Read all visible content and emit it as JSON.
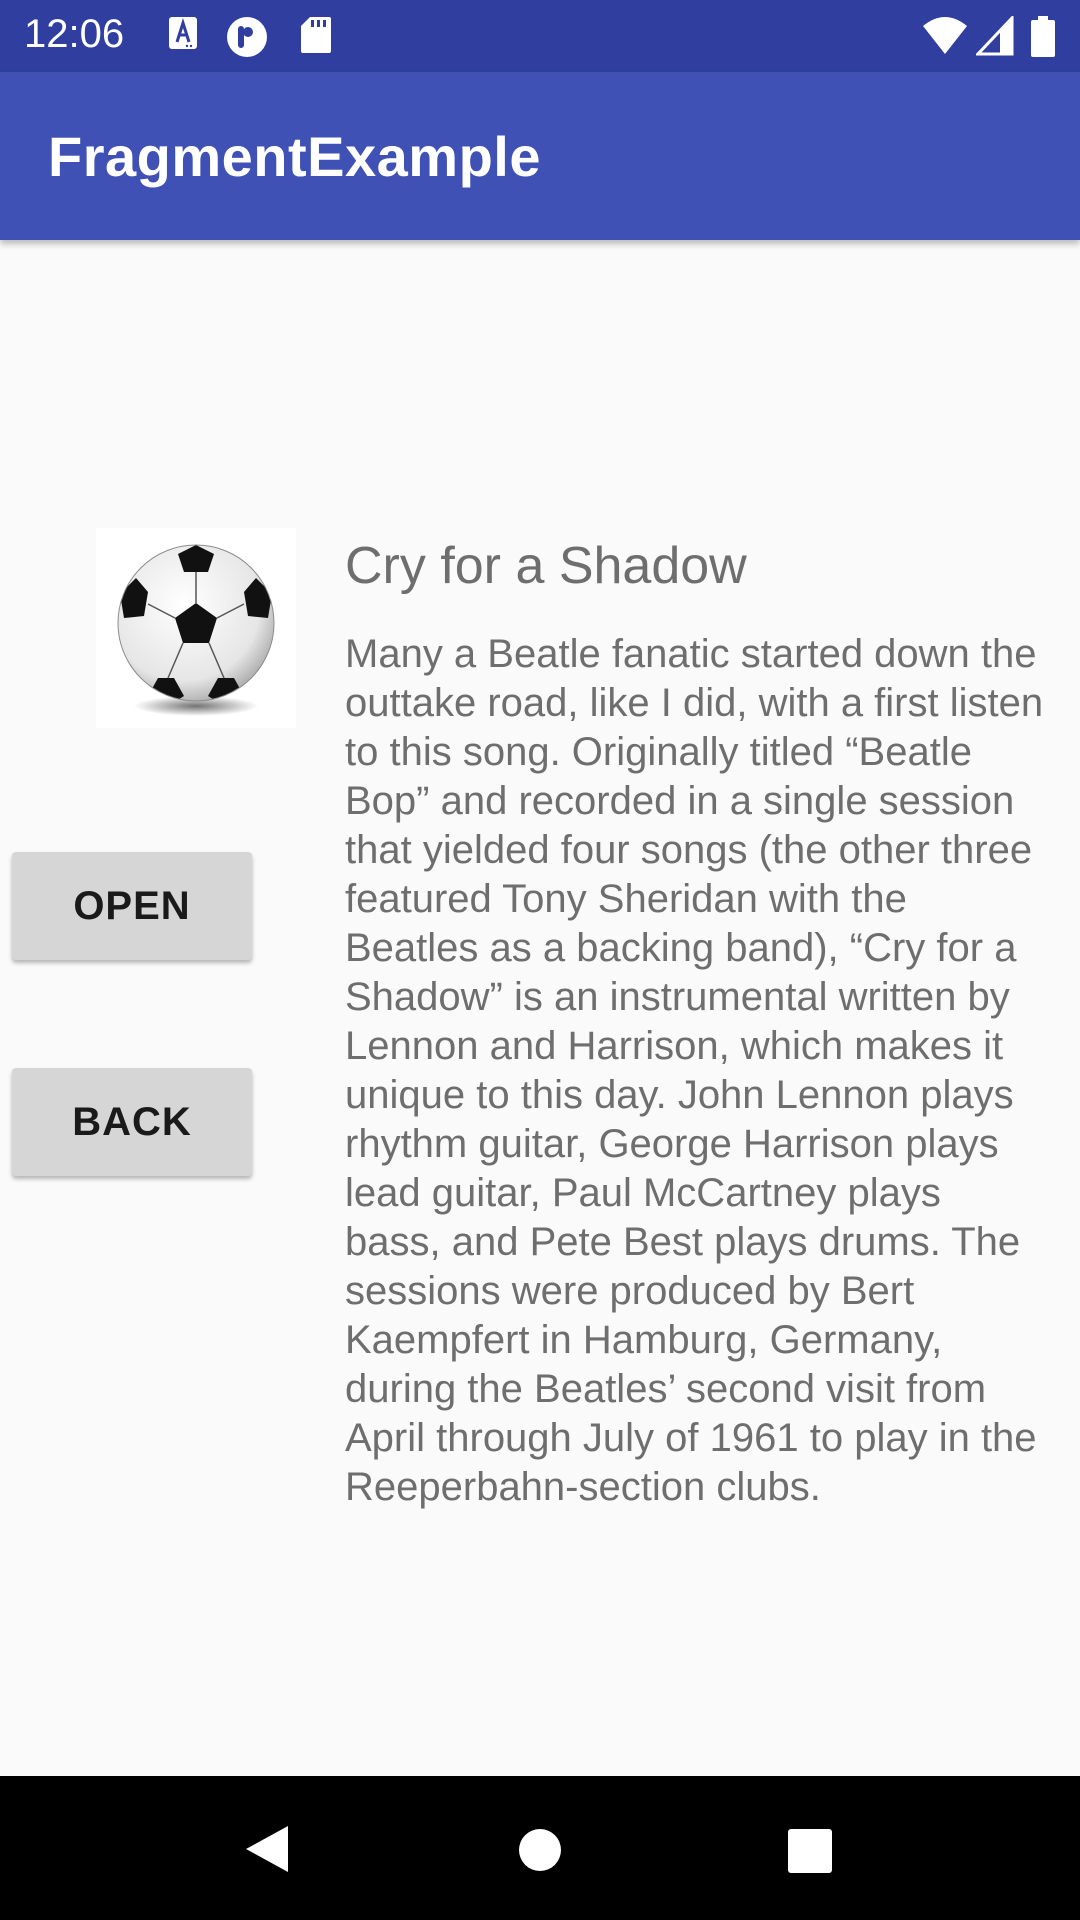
{
  "status_bar": {
    "time": "12:06",
    "left_icons": [
      "a-keyboard-icon",
      "p-app-icon",
      "sd-card-icon"
    ],
    "right_icons": [
      "wifi-icon",
      "signal-icon",
      "battery-icon"
    ]
  },
  "app_bar": {
    "title": "FragmentExample"
  },
  "image": {
    "icon": "soccer-ball-icon"
  },
  "buttons": {
    "open_label": "OPEN",
    "back_label": "BACK"
  },
  "song": {
    "title": "Cry for a Shadow",
    "description": "Many a Beatle fanatic started down the outtake road, like I did, with a first listen to this song. Originally titled “Beatle Bop” and recorded in a single session that yielded four songs (the other three featured Tony Sheridan with the Beatles as a backing band), “Cry for a Shadow” is an instrumental written by Lennon and Harrison, which makes it unique to this day. John Lennon plays rhythm guitar, George Harrison plays lead guitar, Paul McCartney plays bass, and Pete Best plays drums. The sessions were produced by Bert Kaempfert in Hamburg, Germany, during the Beatles’ second visit from April through July of 1961 to play in the Reeperbahn-section clubs."
  },
  "nav_bar": {
    "icons": [
      "back-icon",
      "home-icon",
      "recents-icon"
    ]
  },
  "colors": {
    "status_bar": "#303f9f",
    "app_bar": "#3f51b5",
    "button": "#d6d6d6",
    "text": "#6e6e6e"
  }
}
